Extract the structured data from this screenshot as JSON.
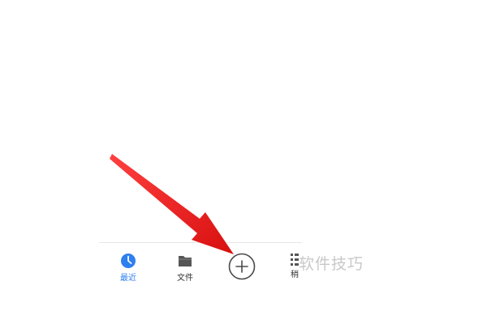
{
  "tabbar": {
    "tabs": [
      {
        "label": "最近",
        "icon": "clock-icon",
        "active": true
      },
      {
        "label": "文件",
        "icon": "folder-icon",
        "active": false
      },
      {
        "label": "稍",
        "icon": "list-icon",
        "active": false
      }
    ],
    "add_button_icon": "plus-icon"
  },
  "watermark": {
    "text": "软件技巧"
  },
  "colors": {
    "accent": "#2e7ff0",
    "arrow": "#e81d1d",
    "icon_gray": "#555555",
    "watermark": "#c8c8c8"
  }
}
